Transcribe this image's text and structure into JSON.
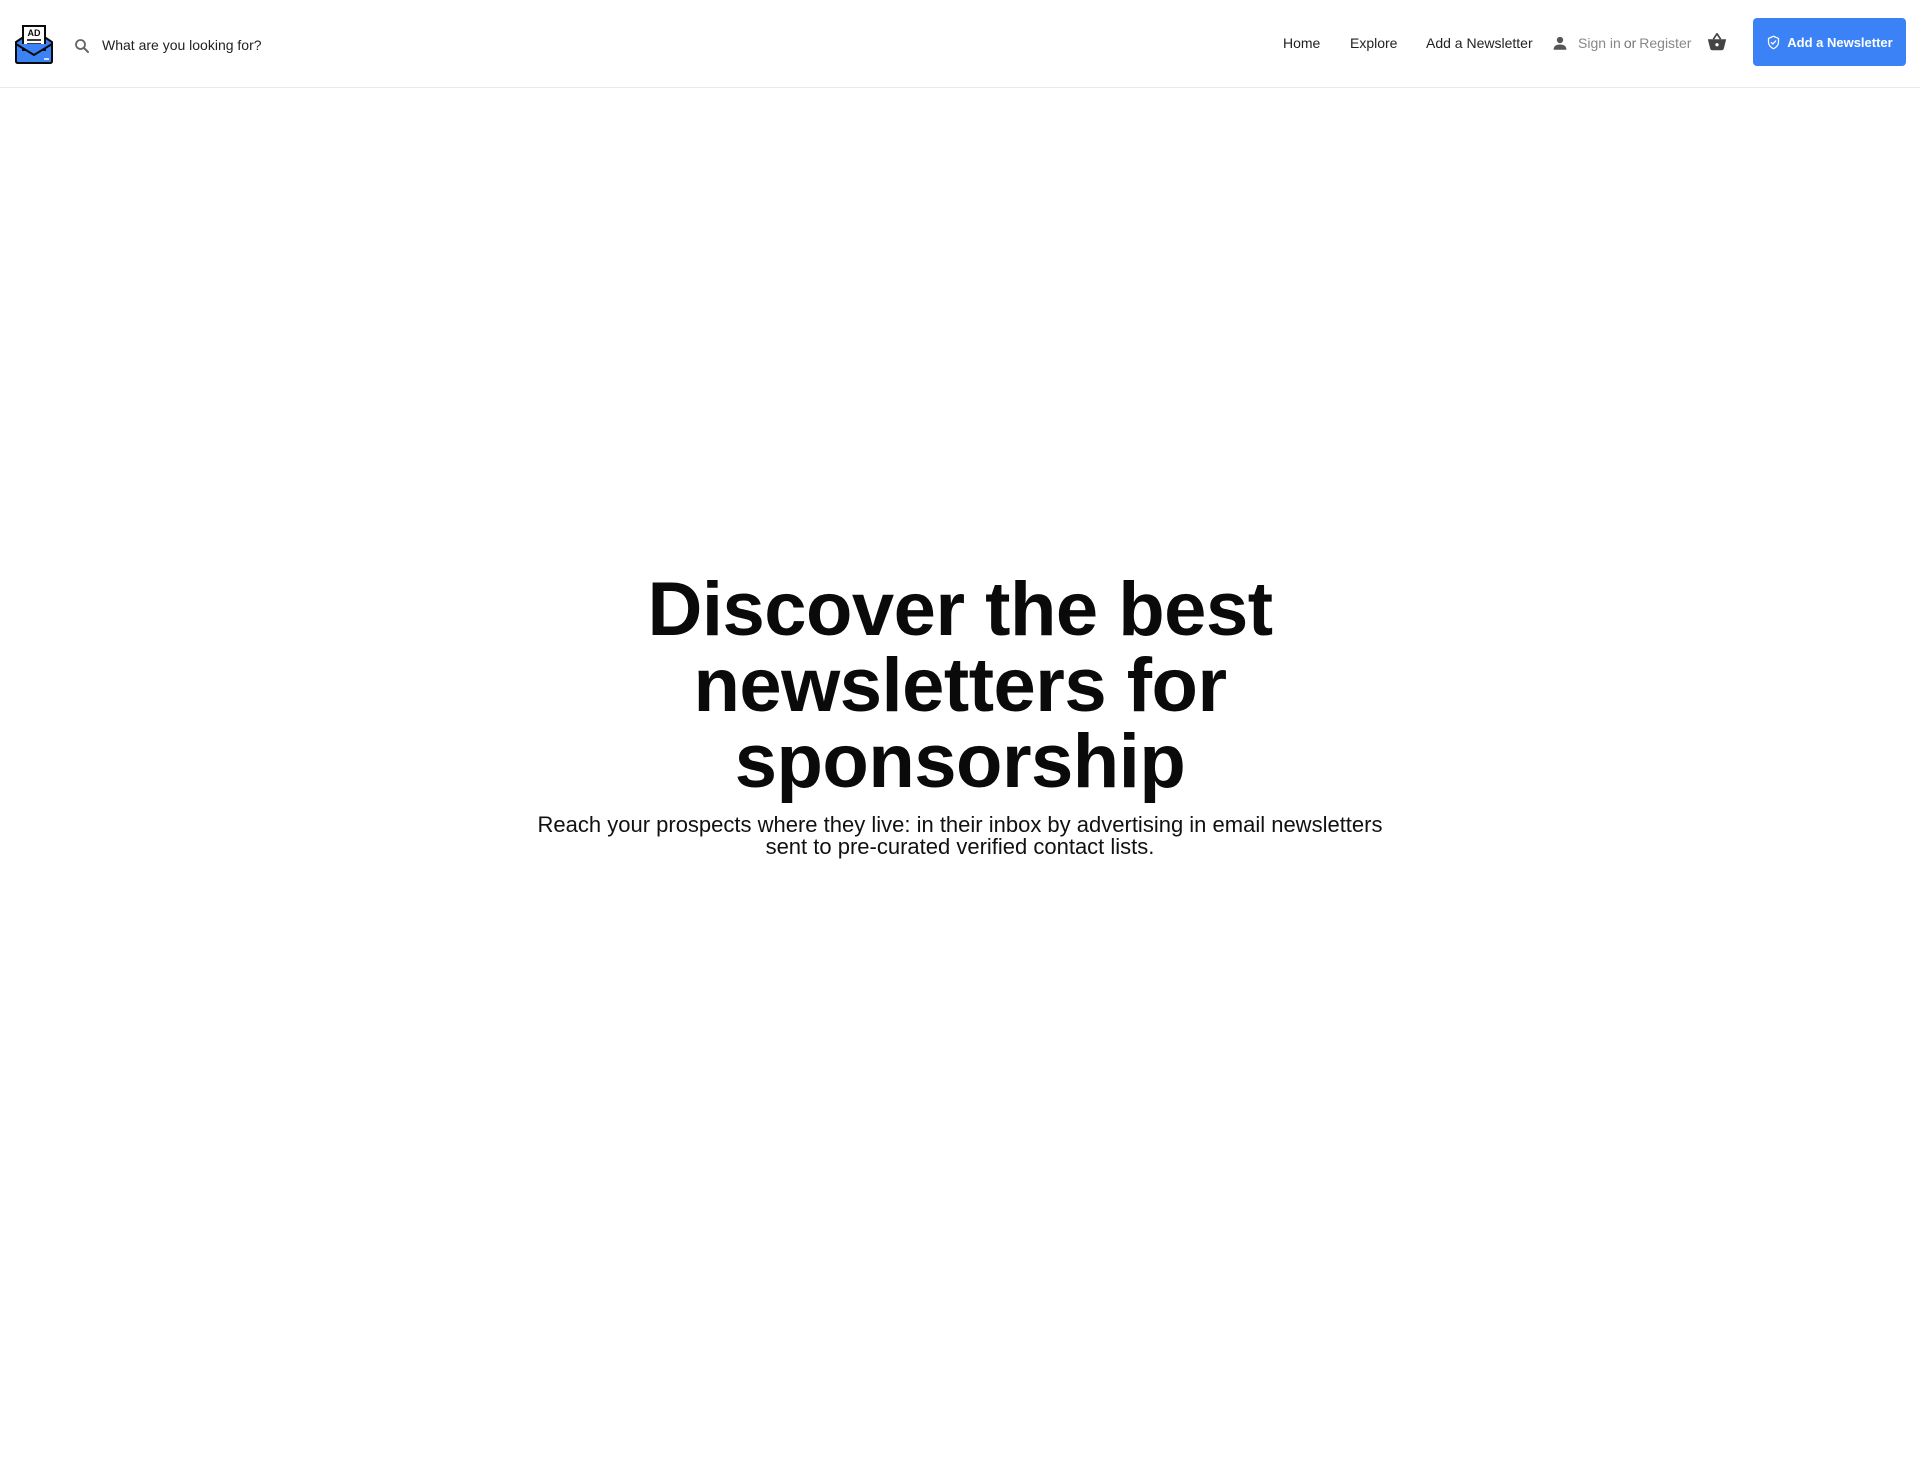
{
  "header": {
    "logo_text": "AD",
    "search": {
      "placeholder": "What are you looking for?"
    },
    "nav": [
      {
        "label": "Home"
      },
      {
        "label": "Explore"
      },
      {
        "label": "Add a Newsletter"
      }
    ],
    "auth": {
      "sign_in": "Sign in",
      "or": "or",
      "register": "Register"
    },
    "cta": {
      "label": "Add a Newsletter"
    },
    "icons": {
      "logo": "ad-envelope-logo",
      "search": "search-icon",
      "user": "user-icon",
      "cart": "basket-icon",
      "cta": "shield-check-icon"
    }
  },
  "hero": {
    "title": "Discover the best newsletters for sponsorship",
    "subtitle": "Reach your prospects where they live: in their inbox by advertising in email newsletters sent to pre-curated verified contact lists."
  },
  "colors": {
    "accent": "#3b82f6",
    "text": "#111111",
    "muted": "#888888",
    "border": "#e9e9e9"
  }
}
